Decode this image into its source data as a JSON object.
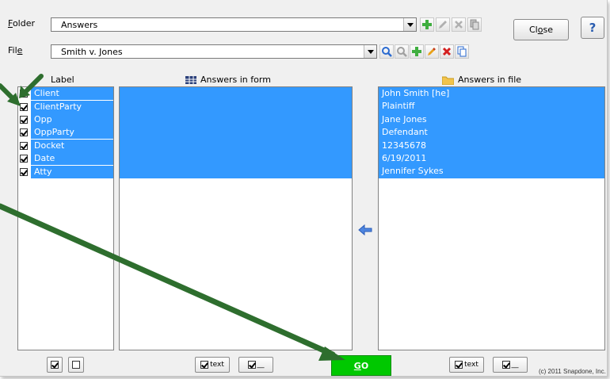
{
  "folder": {
    "label_pre": "",
    "label_u": "F",
    "label_post": "older",
    "value": "Answers"
  },
  "file": {
    "label_pre": "Fil",
    "label_u": "e",
    "label_post": "",
    "value": "Smith v. Jones"
  },
  "buttons": {
    "close_pre": "Cl",
    "close_u": "o",
    "close_post": "se",
    "help": "?",
    "go_u": "G",
    "go_post": "O"
  },
  "headers": {
    "label": "Label",
    "form": "Answers in form",
    "file": "Answers in file"
  },
  "labels": [
    {
      "text": "Client",
      "checked": true
    },
    {
      "text": "ClientParty",
      "checked": true
    },
    {
      "text": "Opp",
      "checked": true
    },
    {
      "text": "OppParty",
      "checked": true
    },
    {
      "text": "Docket",
      "checked": true
    },
    {
      "text": "Date",
      "checked": true
    },
    {
      "text": "Atty",
      "checked": true
    }
  ],
  "answers_in_file": [
    "John Smith [he]",
    "Plaintiff",
    "Jane Jones",
    "Defendant",
    "12345678",
    "6/19/2011",
    "Jennifer Sykes"
  ],
  "bottom": {
    "text": "text",
    "blank": "__"
  },
  "copyright": "(c) 2011 Snapdone, Inc.",
  "colors": {
    "selection": "#3399ff",
    "go": "#00c800",
    "arrow": "#2e6e2e"
  }
}
